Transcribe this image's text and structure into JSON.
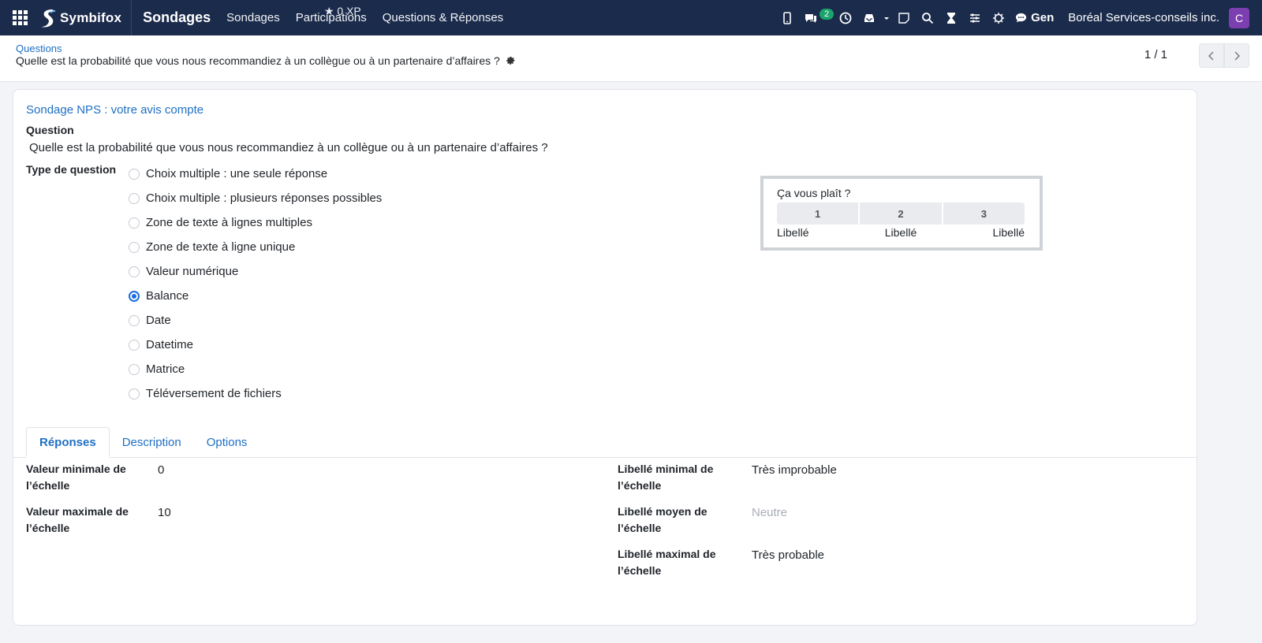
{
  "navbar": {
    "brand": "Symbifox",
    "app_title": "Sondages",
    "menu": [
      "Sondages",
      "Participations",
      "Questions & Réponses"
    ],
    "xp": "0 XP",
    "messages_badge": "2",
    "gen_label": "Gen",
    "company": "Boréal Services-conseils inc.",
    "avatar_letter": "C"
  },
  "breadcrumb": {
    "parent": "Questions",
    "current": "Quelle est la probabilité que vous nous recommandiez à un collègue ou à un partenaire d’affaires ?"
  },
  "pager": {
    "value": "1 / 1"
  },
  "form": {
    "survey": "Sondage NPS : votre avis compte",
    "question_label": "Question",
    "question_text": "Quelle est la probabilité que vous nous recommandiez à un collègue ou à un partenaire d’affaires ?",
    "type_label": "Type de question",
    "types": [
      "Choix multiple : une seule réponse",
      "Choix multiple : plusieurs réponses possibles",
      "Zone de texte à lignes multiples",
      "Zone de texte à ligne unique",
      "Valeur numérique",
      "Balance",
      "Date",
      "Datetime",
      "Matrice",
      "Téléversement de fichiers"
    ],
    "selected_type": "Balance"
  },
  "preview": {
    "title": "Ça vous plaît ?",
    "scale": [
      "1",
      "2",
      "3"
    ],
    "labels": [
      "Libellé",
      "Libellé",
      "Libellé"
    ]
  },
  "tabs": [
    "Réponses",
    "Description",
    "Options"
  ],
  "fields": {
    "min_value_label": "Valeur minimale de l’échelle",
    "min_value": "0",
    "max_value_label": "Valeur maximale de l’échelle",
    "max_value": "10",
    "min_label_label": "Libellé minimal de l’échelle",
    "min_label": "Très improbable",
    "mid_label_label": "Libellé moyen de l’échelle",
    "mid_label_placeholder": "Neutre",
    "max_label_label": "Libellé maximal de l’échelle",
    "max_label": "Très probable"
  },
  "colors": {
    "navbar": "#1b2b4b",
    "link": "#1f6fc4",
    "radio_checked": "#1b6ce0",
    "badge": "#1aa36b",
    "avatar": "#7c3fb0"
  }
}
